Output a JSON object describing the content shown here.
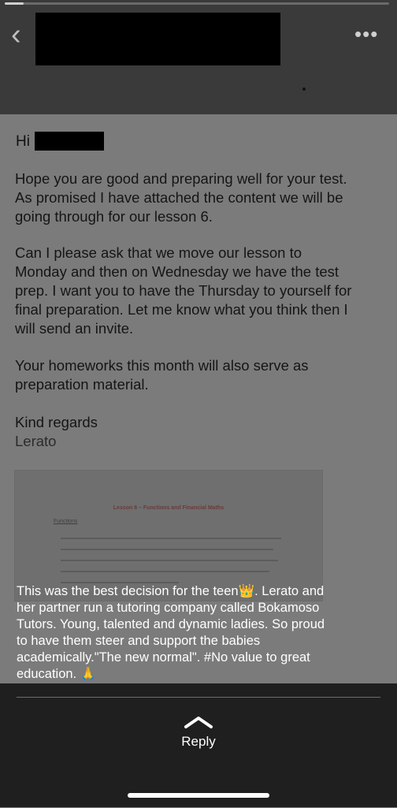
{
  "progress": {
    "value": 0.05
  },
  "header": {
    "back_icon": "chevron-left-icon",
    "more_icon": "more-icon"
  },
  "email": {
    "greeting": "Hi",
    "para1_line1": "Hope you are good and preparing well for your test.",
    "para1_line2": "As promised I have attached the content we will be",
    "para1_line3": "going through for our lesson 6.",
    "para2_line1": "Can I please ask that we move our lesson to",
    "para2_line2": "Monday and then on Wednesday we have the test",
    "para2_line3": "prep. I want you to have the Thursday to yourself for",
    "para2_line4": "final preparation. Let me know what you think then I",
    "para2_line5": "will send an invite.",
    "para3_line1": "Your homeworks this month will also serve as",
    "para3_line2": "preparation material.",
    "closing": "Kind regards",
    "signature": "Lerato"
  },
  "attachment": {
    "title": "Lesson 6 – Functions and Financial Maths",
    "section": "Functions"
  },
  "caption": {
    "line1": "This was the best decision for the teen",
    "line1_end": ". Lerato and",
    "line2": "her partner run a tutoring company called Bokamoso",
    "line3": "Tutors.  Young, talented and dynamic ladies. So proud",
    "line4": "to have them steer and support the babies",
    "line5": "academically.\"The new normal\". #No value to great",
    "line6": "education.",
    "crown_emoji": "👑",
    "pray_emoji": "🙏"
  },
  "footer": {
    "reply_icon": "chevron-up-icon",
    "reply_label": "Reply"
  }
}
